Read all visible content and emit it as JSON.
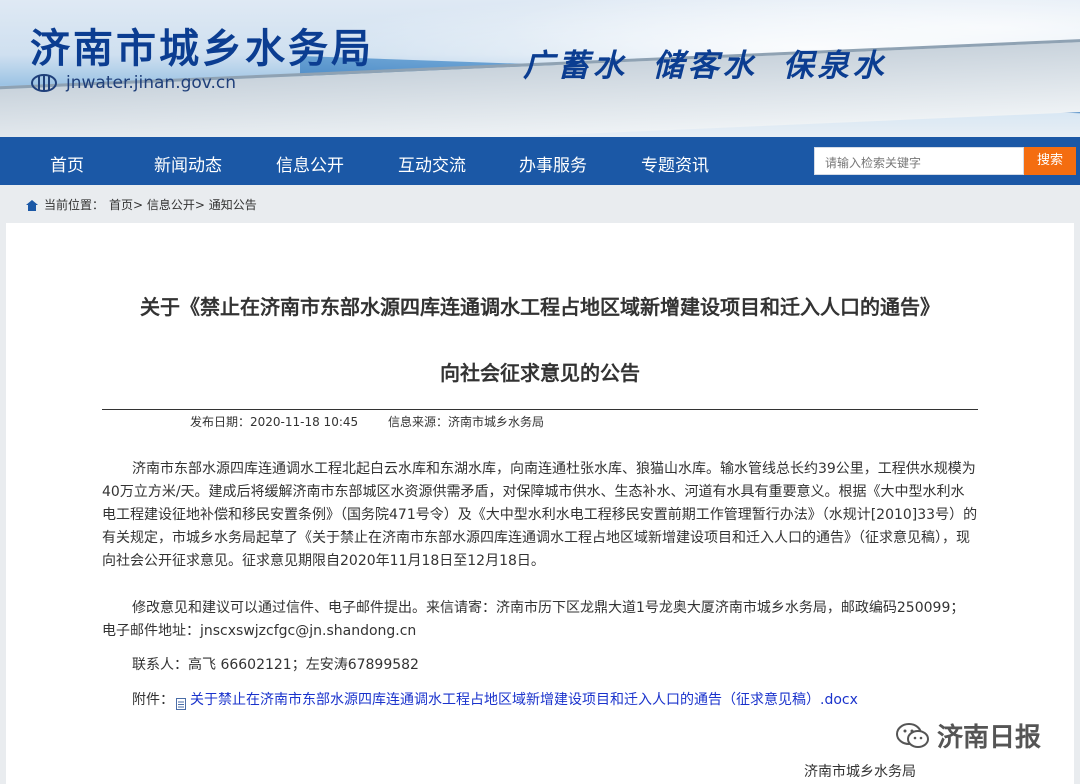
{
  "header": {
    "site_name": "济南市城乡水务局",
    "site_url": "jnwater.jinan.gov.cn",
    "slogan": "广蓄水 储客水 保泉水"
  },
  "nav": {
    "items": [
      "首页",
      "新闻动态",
      "信息公开",
      "互动交流",
      "办事服务",
      "专题资讯"
    ],
    "search_placeholder": "请输入检索关键字",
    "search_button": "搜索"
  },
  "breadcrumb": {
    "label": "当前位置：",
    "path": "首页> 信息公开> 通知公告"
  },
  "article": {
    "title_line1": "关于《禁止在济南市东部水源四库连通调水工程占地区域新增建设项目和迁入人口的通告》",
    "title_line2": "向社会征求意见的公告",
    "publish_date": "发布日期：2020-11-18 10:45",
    "source": "信息来源：济南市城乡水务局",
    "para1": "济南市东部水源四库连通调水工程北起白云水库和东湖水库，向南连通杜张水库、狼猫山水库。输水管线总长约39公里，工程供水规模为40万立方米/天。建成后将缓解济南市东部城区水资源供需矛盾，对保障城市供水、生态补水、河道有水具有重要意义。根据《大中型水利水电工程建设征地补偿和移民安置条例》（国务院471号令）及《大中型水利水电工程移民安置前期工作管理暂行办法》（水规计[2010]33号）的有关规定，市城乡水务局起草了《关于禁止在济南市东部水源四库连通调水工程占地区域新增建设项目和迁入人口的通告》（征求意见稿），现向社会公开征求意见。征求意见期限自2020年11月18日至12月18日。",
    "para2": "修改意见和建议可以通过信件、电子邮件提出。来信请寄：济南市历下区龙鼎大道1号龙奥大厦济南市城乡水务局，邮政编码250099；电子邮件地址：jnscxswjzcfgc@jn.shandong.cn",
    "contact": "联系人：高飞 66602121；左安涛67899582",
    "attachment_label": "附件：",
    "attachment_link": "关于禁止在济南市东部水源四库连通调水工程占地区域新增建设项目和迁入人口的通告（征求意见稿）.docx",
    "signature": "济南市城乡水务局"
  },
  "watermark": {
    "text": "济南日报",
    "icon": "wechat-icon"
  },
  "colors": {
    "nav_bg": "#1b58a6",
    "search_button": "#f46d10",
    "brand_text": "#0b3d91",
    "link": "#1a33cc"
  }
}
